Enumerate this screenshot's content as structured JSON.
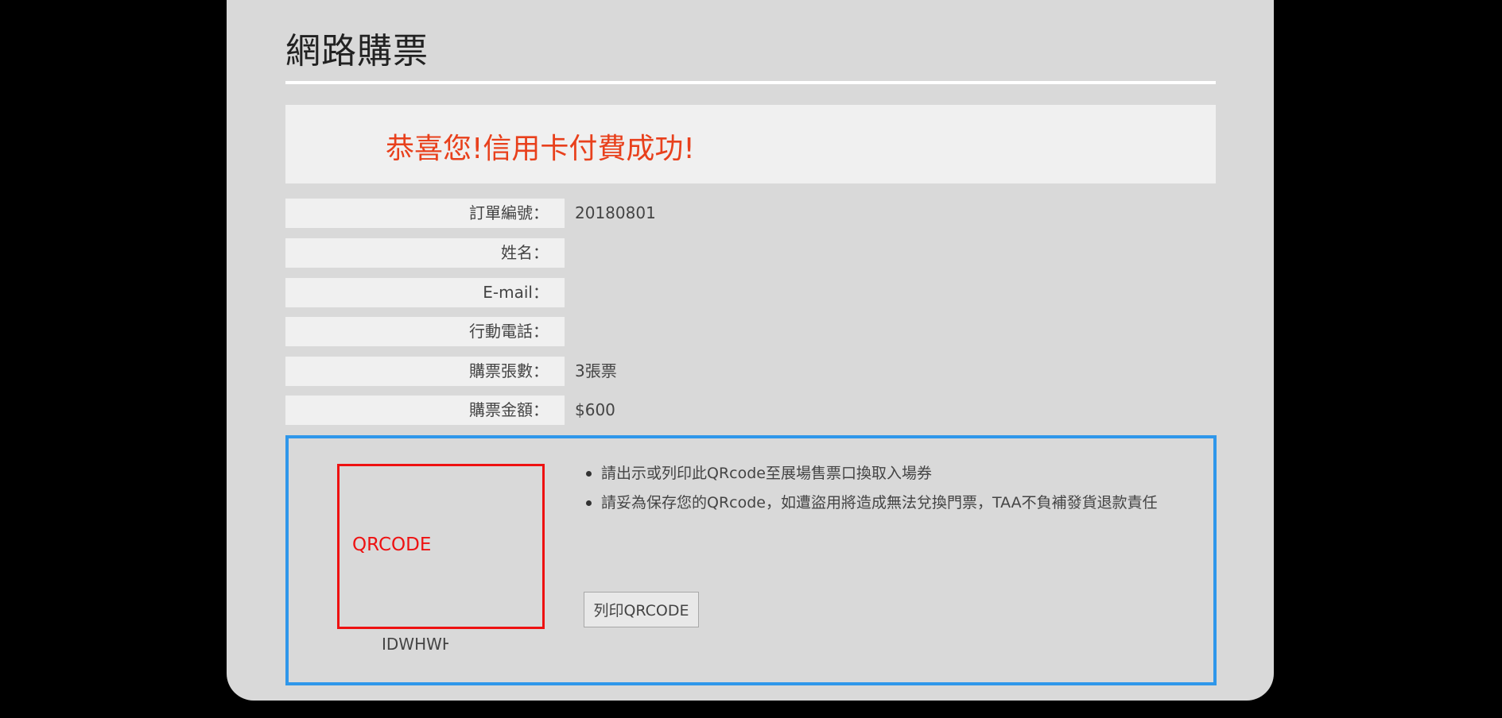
{
  "page": {
    "title": "網路購票"
  },
  "success": {
    "message": "恭喜您!信用卡付費成功!"
  },
  "order": {
    "rows": [
      {
        "label": "訂單編號：",
        "value": "20180801"
      },
      {
        "label": "姓名：",
        "value": ""
      },
      {
        "label": "E-mail：",
        "value": ""
      },
      {
        "label": "行動電話：",
        "value": ""
      },
      {
        "label": "購票張數：",
        "value": "3張票"
      },
      {
        "label": "購票金額：",
        "value": "$600"
      }
    ]
  },
  "qr": {
    "placeholder": "QRCODE",
    "code": "IDWHWH",
    "notes": [
      "請出示或列印此QRcode至展場售票口換取入場券",
      "請妥為保存您的QRcode，如遭盜用將造成無法兌換門票，TAA不負補發貨退款責任"
    ],
    "print_label": "列印QRCODE"
  },
  "colors": {
    "background": "#000000",
    "panel": "#d9d9d9",
    "success": "#e8401c",
    "qr_border": "#2f97ea",
    "qr_box": "#ee1111"
  }
}
